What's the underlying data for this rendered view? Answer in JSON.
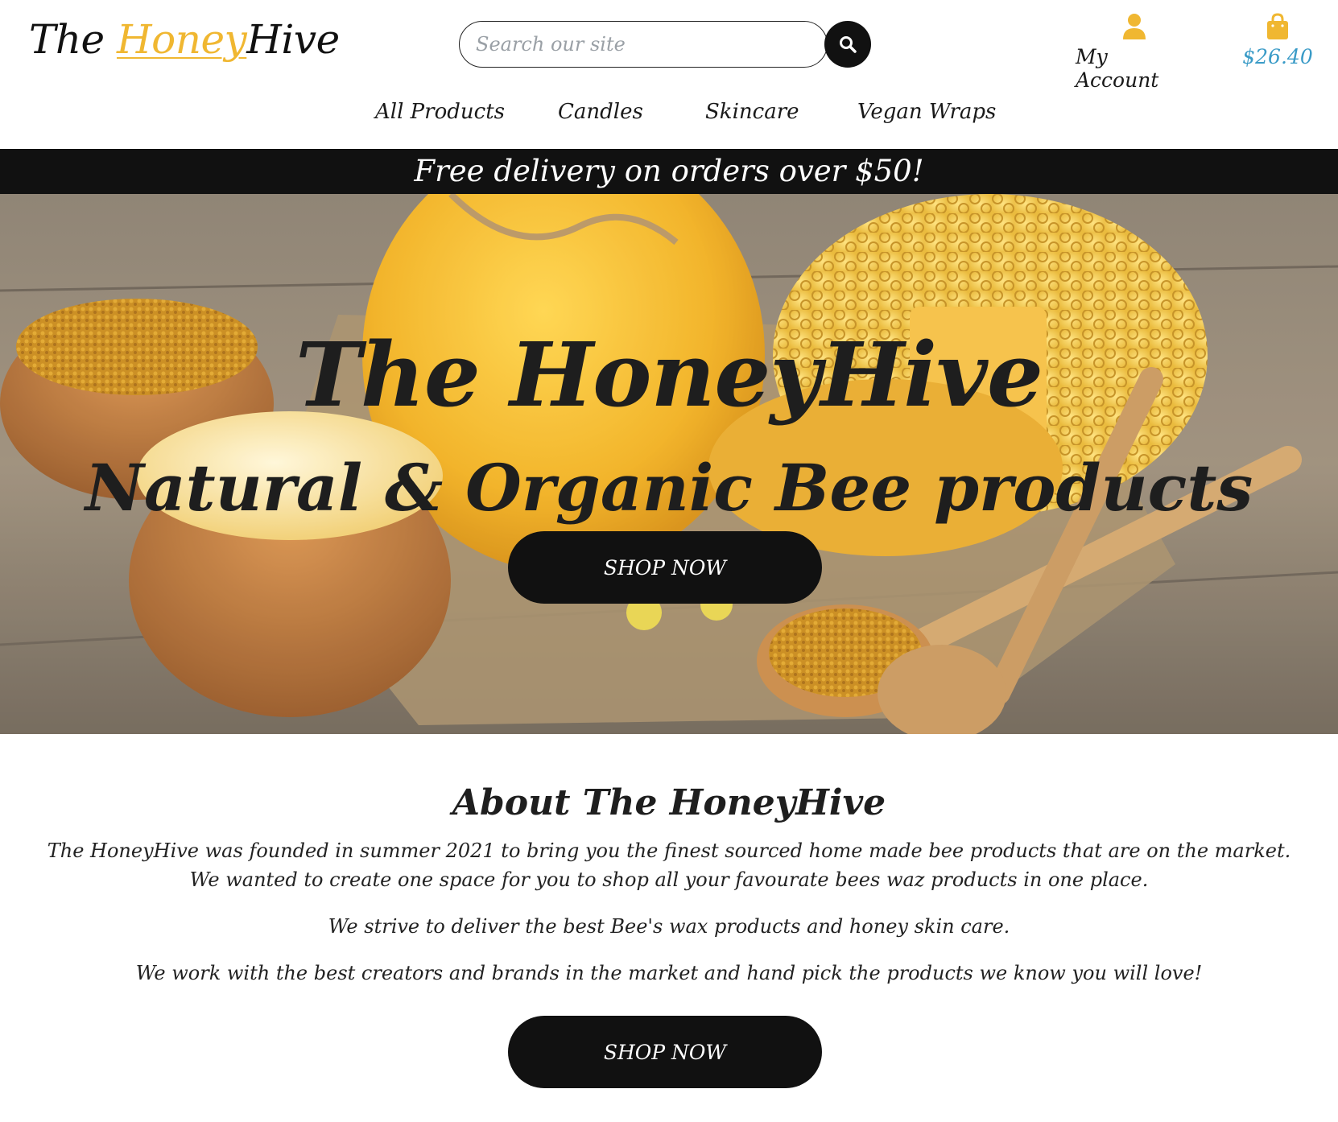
{
  "header": {
    "logo_prefix": "The ",
    "logo_highlight": "Honey",
    "logo_suffix": "Hive",
    "search_placeholder": "Search our site",
    "account_label": "My Account",
    "cart_total": "$26.40"
  },
  "nav": {
    "items": [
      "All Products",
      "Candles",
      "Skincare",
      "Vegan Wraps"
    ]
  },
  "banner": {
    "text": "Free delivery on orders over $50!"
  },
  "hero": {
    "title": "The HoneyHive",
    "subtitle": "Natural & Organic Bee products",
    "button_label": "SHOP NOW"
  },
  "about": {
    "title": "About The HoneyHive",
    "paragraph_1_line_1": "The HoneyHive was founded in summer 2021 to bring you the finest sourced home made bee products that are on the market.",
    "paragraph_1_line_2": "We wanted to create one space for you to shop all your favourate bees waz products in one place.",
    "paragraph_2": "We strive to deliver the best Bee's wax products and honey skin care.",
    "paragraph_3": "We work with the best creators and brands in the market and hand pick the products we know you will love!",
    "button_label": "SHOP NOW"
  },
  "colors": {
    "accent_honey": "#f0b731",
    "cart_blue": "#3a9bc7",
    "dark": "#111111"
  },
  "icons": {
    "search": "search-icon",
    "account": "user-icon",
    "cart": "shopping-bag-icon"
  }
}
